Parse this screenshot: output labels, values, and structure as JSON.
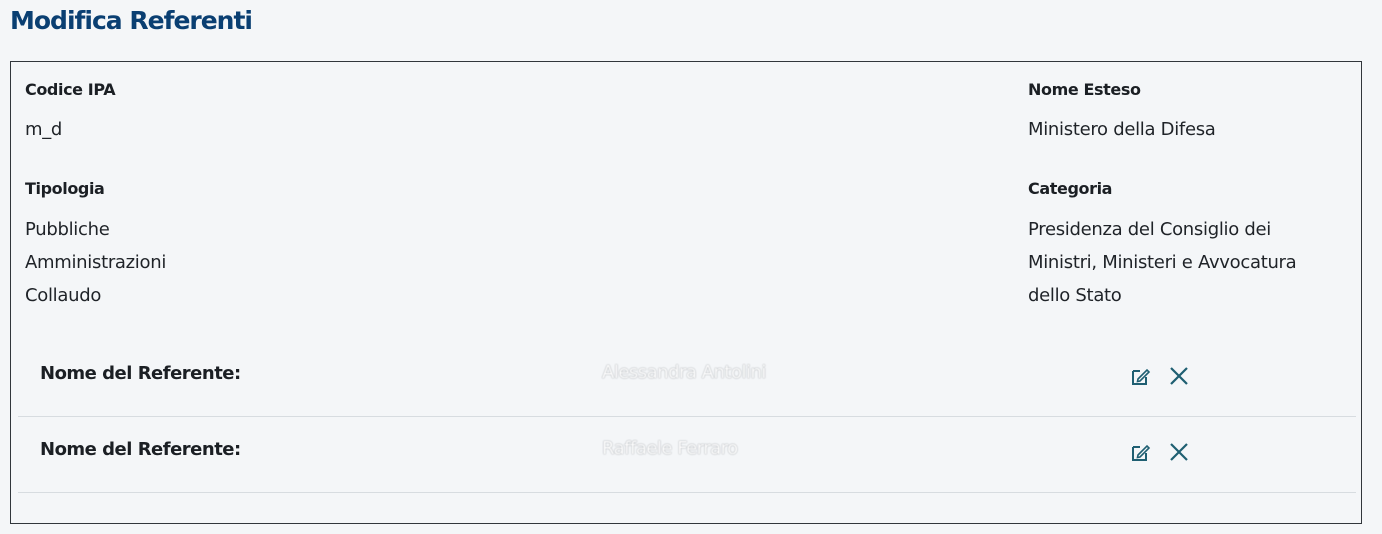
{
  "header": {
    "title": "Modifica Referenti"
  },
  "ente": {
    "codice_ipa_label": "Codice IPA",
    "codice_ipa_value": "m_d",
    "nome_esteso_label": "Nome Esteso",
    "nome_esteso_value": "Ministero della Difesa",
    "tipologia_label": "Tipologia",
    "tipologia_lines": [
      "Pubbliche",
      "Amministrazioni",
      "Collaudo"
    ],
    "categoria_label": "Categoria",
    "categoria_lines": [
      "Presidenza del Consiglio dei",
      "Ministri, Ministeri e Avvocatura",
      "dello Stato"
    ]
  },
  "referenti": [
    {
      "label": "Nome del Referente:",
      "name": "Alessandra Antolini",
      "edit_icon": "edit-icon",
      "delete_icon": "close-icon"
    },
    {
      "label": "Nome del Referente:",
      "name": "Raffaele Ferraro",
      "edit_icon": "edit-icon",
      "delete_icon": "close-icon"
    }
  ],
  "colors": {
    "title": "#0a3f72",
    "icon": "#1f5f72",
    "border": "#31363b",
    "divider": "#d7dce0",
    "background": "#f4f6f8"
  }
}
